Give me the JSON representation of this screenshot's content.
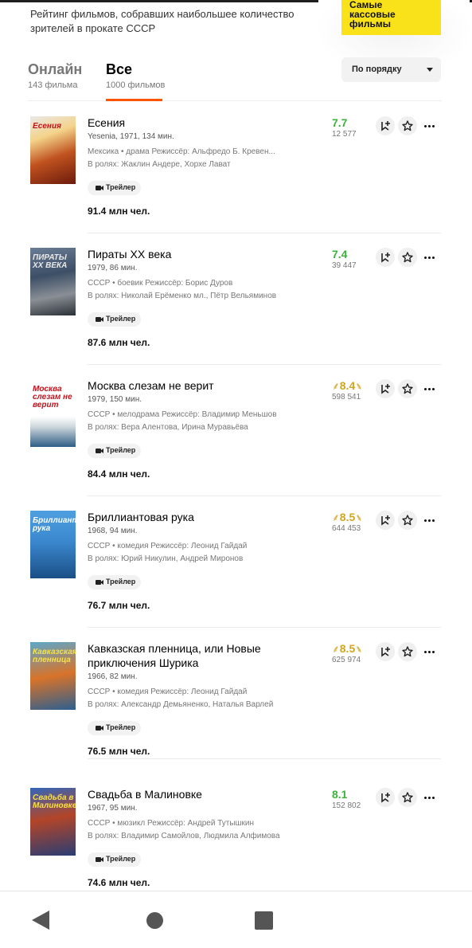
{
  "header": {
    "description": "Рейтинг фильмов, собравших наибольшее количество зрителей в прокате СССР",
    "promo_line1": "Самые",
    "promo_line2": "кассовые",
    "promo_line3": "фильмы"
  },
  "tabs": [
    {
      "label": "Онлайн",
      "count": "143 фильма"
    },
    {
      "label": "Все",
      "count": "1000 фильмов"
    }
  ],
  "sort": {
    "label": "По порядку"
  },
  "trailer_label": "Трейлер",
  "movies": [
    {
      "title": "Есения",
      "meta": "Yesenia, 1971, 134 мин.",
      "info": "Мексика • драма  Режиссёр: Альфредо Б. Кревен...",
      "cast": "В ролях: Жаклин Андере, Хорхе Лават",
      "viewers": "91.4 млн чел.",
      "rating": "7.7",
      "votes": "12 577",
      "top": false,
      "poster_text": "Есения"
    },
    {
      "title": "Пираты XX века",
      "meta": "1979, 86 мин.",
      "info": "СССР • боевик  Режиссёр: Борис Дуров",
      "cast": "В ролях: Николай Ерёменко мл., Пётр Вельяминов",
      "viewers": "87.6 млн чел.",
      "rating": "7.4",
      "votes": "39 447",
      "top": false,
      "poster_text": "ПИРАТЫ XX ВЕКА"
    },
    {
      "title": "Москва слезам не верит",
      "meta": "1979, 150 мин.",
      "info": "СССР • мелодрама  Режиссёр: Владимир Меньшов",
      "cast": "В ролях: Вера Алентова, Ирина Муравьёва",
      "viewers": "84.4 млн чел.",
      "rating": "8.4",
      "votes": "598 541",
      "top": true,
      "poster_text": "Москва слезам не верит"
    },
    {
      "title": "Бриллиантовая рука",
      "meta": "1968, 94 мин.",
      "info": "СССР • комедия  Режиссёр: Леонид Гайдай",
      "cast": "В ролях: Юрий Никулин, Андрей Миронов",
      "viewers": "76.7 млн чел.",
      "rating": "8.5",
      "votes": "644 453",
      "top": true,
      "poster_text": "Бриллиантовая рука"
    },
    {
      "title": "Кавказская пленница, или Новые приключения Шурика",
      "meta": "1966, 82 мин.",
      "info": "СССР • комедия  Режиссёр: Леонид Гайдай",
      "cast": "В ролях: Александр Демьяненко, Наталья Варлей",
      "viewers": "76.5 млн чел.",
      "rating": "8.5",
      "votes": "625 974",
      "top": true,
      "poster_text": "Кавказская пленница"
    },
    {
      "title": "Свадьба в Малиновке",
      "meta": "1967, 95 мин.",
      "info": "СССР • мюзикл  Режиссёр: Андрей Тутышкин",
      "cast": "В ролях: Владимир Самойлов, Людмила Алфимова",
      "viewers": "74.6 млн чел.",
      "rating": "8.1",
      "votes": "152 802",
      "top": false,
      "poster_text": "Свадьба в Малиновке"
    }
  ],
  "colors": {
    "accent": "#ff5500",
    "rating_green": "#3bb33b",
    "rating_gold": "#d2a51f",
    "promo_yellow": "#f9e21a"
  },
  "icons": [
    "video-camera-icon",
    "add-to-folder-icon",
    "star-icon",
    "more-icon",
    "back-icon",
    "home-icon",
    "recent-apps-icon"
  ]
}
